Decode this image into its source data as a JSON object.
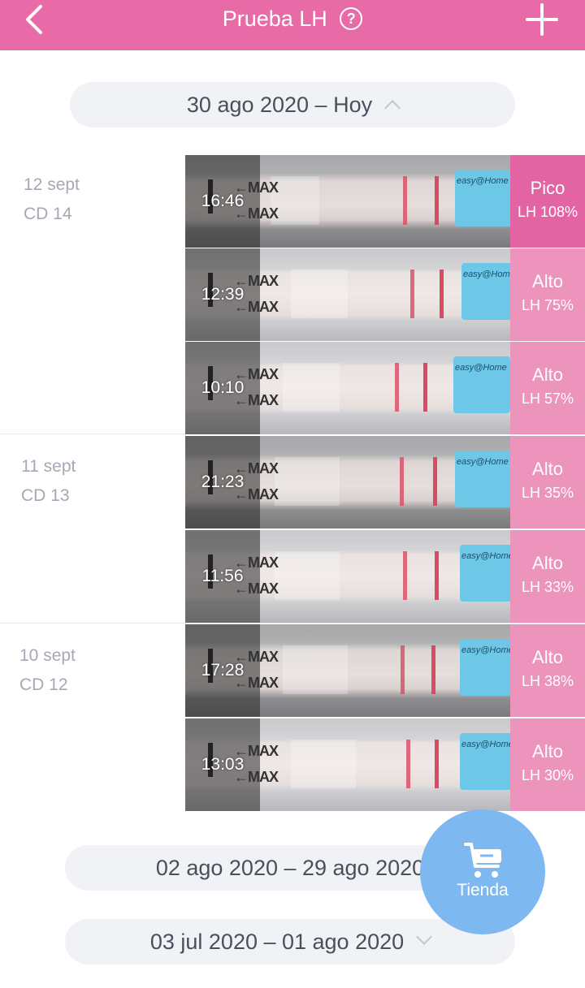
{
  "header": {
    "title": "Prueba LH",
    "help_icon": "?"
  },
  "current_period": {
    "label": "30 ago 2020 – Hoy"
  },
  "days": [
    {
      "date": "12 sept",
      "cycle_day": "CD 14"
    },
    {
      "date": "11 sept",
      "cycle_day": "CD 13"
    },
    {
      "date": "10 sept",
      "cycle_day": "CD 12"
    }
  ],
  "tests": [
    {
      "time": "16:46",
      "level": "Pico",
      "lh": "LH 108%"
    },
    {
      "time": "12:39",
      "level": "Alto",
      "lh": "LH 75%"
    },
    {
      "time": "10:10",
      "level": "Alto",
      "lh": "LH 57%"
    },
    {
      "time": "21:23",
      "level": "Alto",
      "lh": "LH 35%"
    },
    {
      "time": "11:56",
      "level": "Alto",
      "lh": "LH 33%"
    },
    {
      "time": "17:28",
      "level": "Alto",
      "lh": "LH 38%"
    },
    {
      "time": "13:03",
      "level": "Alto",
      "lh": "LH 30%"
    }
  ],
  "strip_text": {
    "max": "←MAX",
    "brand": "easy@Home",
    "brand_short": "LH"
  },
  "previous_periods": [
    {
      "label": "02 ago 2020 – 29 ago 2020"
    },
    {
      "label": "03 jul 2020 – 01 ago 2020"
    }
  ],
  "store": {
    "label": "Tienda"
  },
  "colors": {
    "header": "#e86aa6",
    "peak": "#e264a2",
    "high": "#e97daf",
    "fab": "#7db9f0"
  }
}
